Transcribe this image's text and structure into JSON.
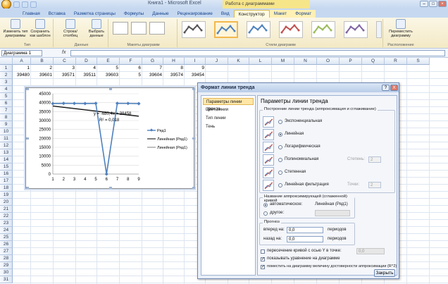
{
  "window": {
    "title": "Книга1 - Microsoft Excel",
    "context_band": "Работа с диаграммами"
  },
  "tabs": [
    "Главная",
    "Вставка",
    "Разметка страницы",
    "Формулы",
    "Данные",
    "Рецензирование",
    "Вид",
    "Конструктор",
    "Макет",
    "Формат"
  ],
  "ribbon": {
    "type_group": {
      "change_type": "Изменить тип диаграммы",
      "save_template": "Сохранить как шаблон",
      "label": "Тип"
    },
    "data_group": {
      "row_col": "Строка/столбец",
      "select_data": "Выбрать данные",
      "label": "Данные"
    },
    "layouts_label": "Макеты диаграмм",
    "styles_label": "Стили диаграмм",
    "location_group": {
      "move": "Переместить диаграмму",
      "label": "Расположение"
    },
    "style_colors": [
      "#555555",
      "#4f81bd",
      "#4f81bd",
      "#c0504d",
      "#9bbb59",
      "#8064a2"
    ]
  },
  "formula_bar": {
    "name_box": "Диаграмма 1",
    "fx": "fx",
    "value": ""
  },
  "columns": [
    "A",
    "B",
    "C",
    "D",
    "E",
    "F",
    "G",
    "H",
    "I",
    "J",
    "K",
    "L",
    "M",
    "N",
    "O",
    "P",
    "Q",
    "R",
    "S"
  ],
  "rows": [
    "1",
    "2",
    "3",
    "4",
    "5",
    "6",
    "7",
    "8",
    "9",
    "10",
    "11",
    "12",
    "13",
    "14",
    "15",
    "16",
    "17",
    "18",
    "19",
    "20",
    "21",
    "22",
    "23",
    "24",
    "25",
    "26",
    "27",
    "28",
    "29",
    "30",
    "31"
  ],
  "row1": [
    "1",
    "2",
    "3",
    "4",
    "5",
    "6",
    "7",
    "8",
    "9"
  ],
  "row2": [
    "39480",
    "39601",
    "39571",
    "39511",
    "39603",
    "5",
    "39604",
    "39574",
    "39454"
  ],
  "chart_data": {
    "type": "line",
    "x": [
      1,
      2,
      3,
      4,
      5,
      6,
      7,
      8,
      9
    ],
    "series": [
      {
        "name": "Ряд1",
        "values": [
          39480,
          39601,
          39571,
          39511,
          39603,
          5,
          39604,
          39574,
          39454
        ],
        "color": "#4f81bd"
      },
      {
        "name": "Линейная (Ряд1)",
        "kind": "trend",
        "color": "#000000"
      },
      {
        "name": "Линейная (Ряд1)",
        "kind": "trend",
        "color": "#7f7f7f"
      }
    ],
    "ylim": [
      0,
      45000
    ],
    "yticks": [
      "45000",
      "40000",
      "35000",
      "30000",
      "25000",
      "20000",
      "15000",
      "10000",
      "5000",
      "0"
    ],
    "xticks": [
      "1",
      "2",
      "3",
      "4",
      "5",
      "6",
      "7",
      "8",
      "9"
    ],
    "equation": "y = -680,4x + 38458",
    "r2": "R² = 0,018",
    "trend_line": [
      38049.6,
      32334.4
    ],
    "trend_line2": [
      38280,
      32600
    ],
    "legend_position": "right"
  },
  "dialog": {
    "title": "Формат линии тренда",
    "help": "?",
    "close_x": "X",
    "nav": [
      "Параметры линии тренда",
      "Цвет линии",
      "Тип линии",
      "Тень"
    ],
    "heading": "Параметры линии тренда",
    "build_legend": "Построение линии тренда (аппроксимация и сглаживание)",
    "options": [
      {
        "label": "Экспоненциальная",
        "selected": false
      },
      {
        "label": "Линейная",
        "selected": true
      },
      {
        "label": "Логарифмическая",
        "selected": false
      },
      {
        "label": "Полиномиальная",
        "selected": false,
        "extra": "Степень:",
        "extra_value": "2"
      },
      {
        "label": "Степенная",
        "selected": false
      },
      {
        "label": "Линейная фильтрация",
        "selected": false,
        "extra": "Точки:",
        "extra_value": "2"
      }
    ],
    "name_legend": "Название аппроксимирующей (сглаженной) кривой",
    "name_auto": "автоматическое:",
    "name_auto_value": "Линейная (Ряд1)",
    "name_other": "другое:",
    "forecast_legend": "Прогноз",
    "forward_label": "вперед на:",
    "forward_value": "0,0",
    "backward_label": "назад на:",
    "backward_value": "0,0",
    "periods": "периодов",
    "intercept_label": "пересечение кривой с осью Y в точке:",
    "intercept_value": "0,0",
    "show_equation": "показывать уравнение на диаграмме",
    "show_r2": "поместить на диаграмму величину достоверности аппроксимации (R^2)",
    "close_button": "Закрыть"
  }
}
